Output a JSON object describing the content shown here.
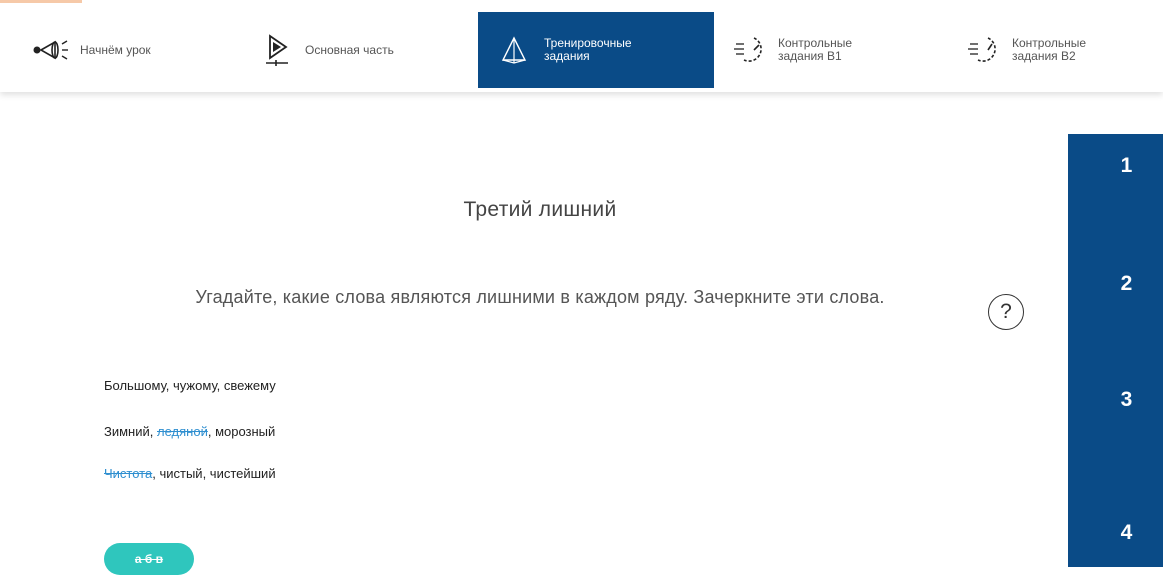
{
  "nav": {
    "items": [
      {
        "label": "Начнём урок"
      },
      {
        "label": "Основная часть"
      },
      {
        "label": "Тренировочные\nзадания"
      },
      {
        "label": "Контрольные\nзадания В1"
      },
      {
        "label": "Контрольные\nзадания В2"
      }
    ]
  },
  "task_numbers": [
    "1",
    "2",
    "3",
    "4"
  ],
  "main": {
    "title": "Третий лишний",
    "instruction": "Угадайте, какие слова являются лишними в каждом ряду. Зачеркните эти слова.",
    "help_symbol": "?",
    "rows": [
      {
        "w1": "Большому",
        "sep1": ", ",
        "w2": "чужому",
        "sep2": ", ",
        "w3": "свежему"
      },
      {
        "w1": "Зимний",
        "sep1": ", ",
        "w2": "ледяной",
        "sep2": ", ",
        "w3": "морозный"
      },
      {
        "w1": "Чистота",
        "sep1": ", ",
        "w2": "чистый",
        "sep2": ", ",
        "w3": "чистейший"
      }
    ],
    "answer_button": "а б в"
  },
  "colors": {
    "primary": "#0a4b87",
    "accent": "#2fc6bd",
    "struck": "#2f8fd0"
  }
}
